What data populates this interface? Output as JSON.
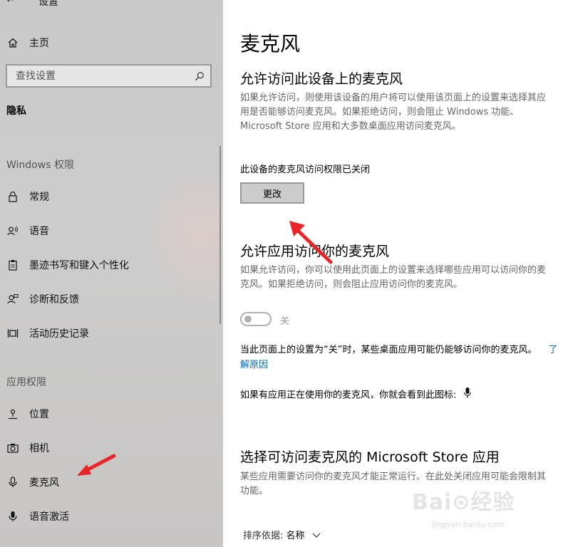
{
  "window": {
    "title": "设置",
    "back_icon": "back-arrow-icon"
  },
  "sidebar": {
    "home_label": "主页",
    "search": {
      "placeholder": "查找设置",
      "value": ""
    },
    "section_title": "隐私",
    "groups": [
      {
        "heading": "Windows 权限",
        "items": [
          {
            "label": "常规",
            "icon": "lock-icon"
          },
          {
            "label": "语音",
            "icon": "speech-icon"
          },
          {
            "label": "墨迹书写和键入个性化",
            "icon": "clipboard-icon"
          },
          {
            "label": "诊断和反馈",
            "icon": "feedback-icon"
          },
          {
            "label": "活动历史记录",
            "icon": "timeline-icon"
          }
        ]
      },
      {
        "heading": "应用权限",
        "items": [
          {
            "label": "位置",
            "icon": "location-icon"
          },
          {
            "label": "相机",
            "icon": "camera-icon"
          },
          {
            "label": "麦克风",
            "icon": "microphone-icon",
            "selected": true
          },
          {
            "label": "语音激活",
            "icon": "voice-activation-icon"
          }
        ]
      }
    ]
  },
  "main": {
    "title": "麦克风",
    "device_section": {
      "heading": "允许访问此设备上的麦克风",
      "description": "如果允许访问，则使用该设备的用户将可以使用该页面上的设置来选择其应用是否能够访问麦克风。如果拒绝访问，则会阻止 Windows 功能、Microsoft Store 应用和大多数桌面应用访问麦克风。",
      "status": "此设备的麦克风访问权限已关闭",
      "button_label": "更改"
    },
    "app_section": {
      "heading": "允许应用访问你的麦克风",
      "description": "如果允许访问，你可以使用此页面上的设置来选择哪些应用可以访问你的麦克风。如果拒绝访问，则会阻止应用访问你的麦克风。",
      "toggle_state": "关",
      "note": "当此页面上的设置为“关”时，某些桌面应用可能仍能够访问你的麦克风。",
      "link": "了解原因",
      "icon_note": "如果有应用正在使用你的麦克风，你就会看到此图标:"
    },
    "store_section": {
      "heading": "选择可访问麦克风的 Microsoft Store 应用",
      "description": "某些应用需要访问你的麦克风才能正常运行。在此处关闭应用可能会限制其功能。",
      "sort_label": "排序依据:",
      "sort_value": "名称"
    }
  },
  "watermark": {
    "brand": "Bai⊙经验",
    "url": "jingyan.baidu.com"
  },
  "colors": {
    "link": "#0a68c5",
    "annotation_arrow": "#e8262a",
    "sidebar_bg": "#cbcbcb"
  }
}
